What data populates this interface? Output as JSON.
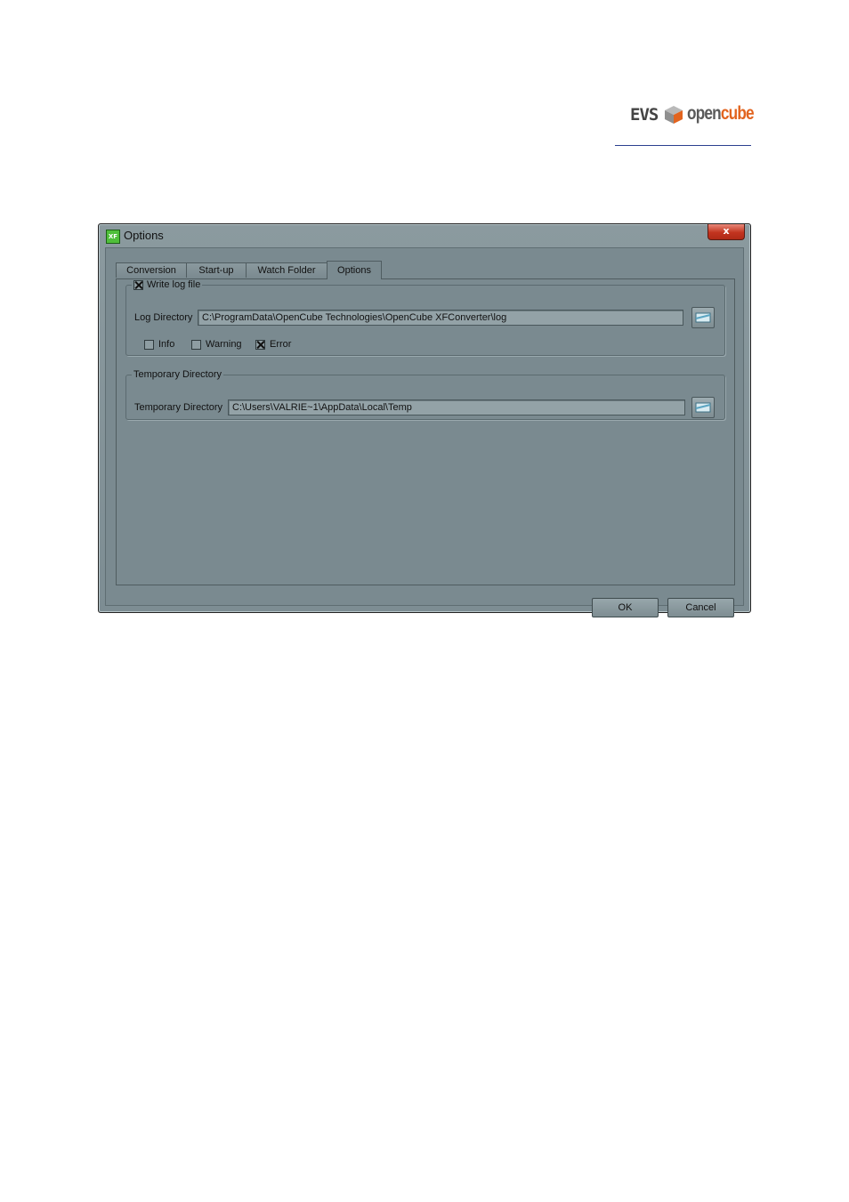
{
  "logo": {
    "evs": "EVS",
    "open": "open",
    "cube": "cube"
  },
  "window": {
    "title": "Options",
    "app_icon": "XF",
    "close_glyph": "x",
    "tabs": [
      {
        "label": "Conversion"
      },
      {
        "label": "Start-up"
      },
      {
        "label": "Watch Folder"
      },
      {
        "label": "Options",
        "active": true
      }
    ],
    "log_group": {
      "title": "Write log file",
      "checked": true,
      "dir_label": "Log Directory",
      "dir_value": "C:\\ProgramData\\OpenCube Technologies\\OpenCube XFConverter\\log",
      "levels": [
        {
          "label": "Info",
          "checked": false
        },
        {
          "label": "Warning",
          "checked": false
        },
        {
          "label": "Error",
          "checked": true
        }
      ]
    },
    "temp_group": {
      "title": "Temporary Directory",
      "dir_label": "Temporary Directory",
      "dir_value": "C:\\Users\\VALRIE~1\\AppData\\Local\\Temp"
    },
    "ok_label": "OK",
    "cancel_label": "Cancel"
  },
  "icons": {
    "browse": "folder-browse-icon",
    "check": "check-x-icon"
  },
  "colors": {
    "window_bg": "#7a8a90",
    "close_red": "#c2341f",
    "brand_orange": "#e2641f"
  }
}
